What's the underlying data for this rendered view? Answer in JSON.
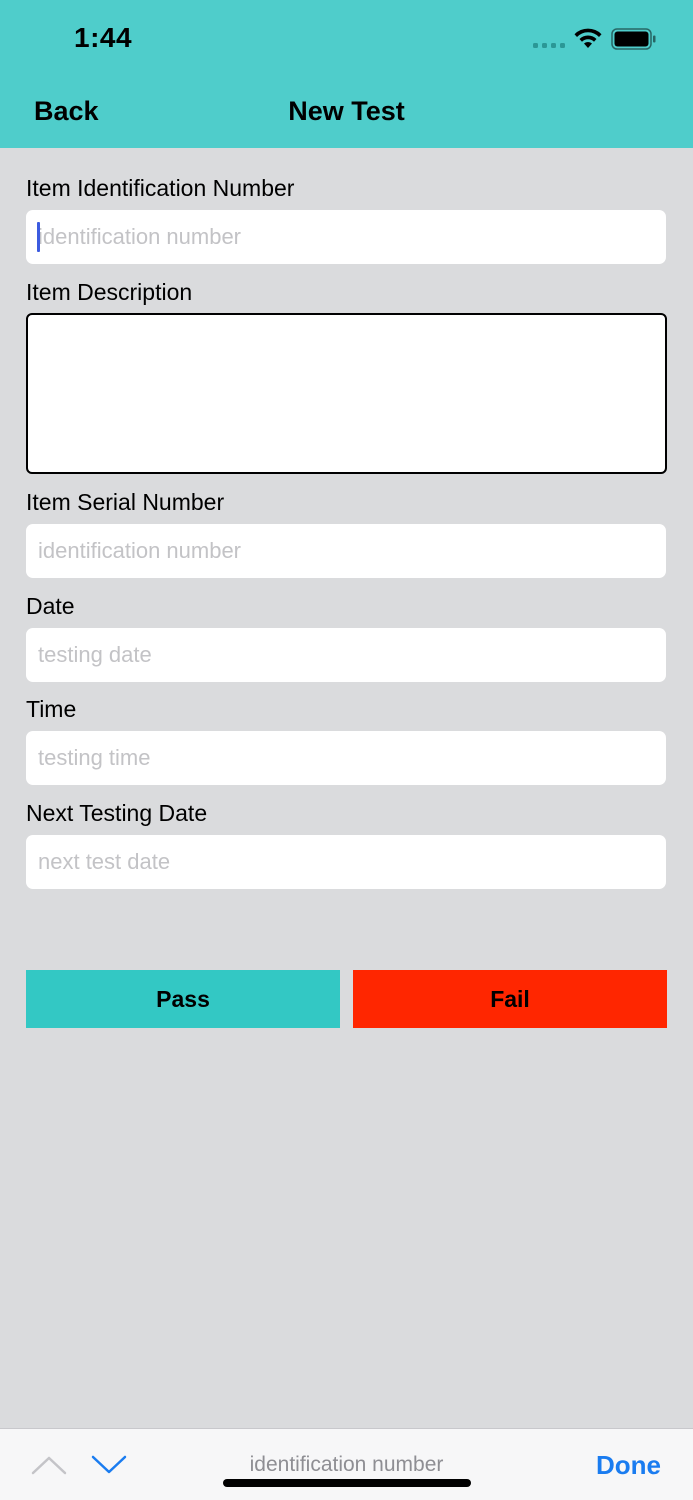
{
  "status_bar": {
    "time": "1:44"
  },
  "nav": {
    "back_label": "Back",
    "title": "New Test"
  },
  "form": {
    "fields": [
      {
        "label": "Item Identification Number",
        "placeholder": "identification number",
        "value": ""
      },
      {
        "label": "Item Description",
        "value": ""
      },
      {
        "label": "Item Serial Number",
        "placeholder": "identification number",
        "value": ""
      },
      {
        "label": "Date",
        "placeholder": "testing date",
        "value": ""
      },
      {
        "label": "Time",
        "placeholder": "testing time",
        "value": ""
      },
      {
        "label": "Next Testing Date",
        "placeholder": "next test date",
        "value": ""
      }
    ]
  },
  "actions": {
    "pass_label": "Pass",
    "fail_label": "Fail"
  },
  "toolbar": {
    "current_field": "identification number",
    "done_label": "Done"
  },
  "icons": {
    "signal": "cellular-signal-icon",
    "wifi": "wifi-icon",
    "battery": "battery-icon",
    "prev": "chevron-up-icon",
    "next": "chevron-down-icon"
  },
  "colors": {
    "header": "#4fcdcb",
    "background": "#dadbdd",
    "pass": "#33c8c4",
    "fail": "#ff2600",
    "done": "#1a7cf0",
    "caret": "#3c5be0"
  }
}
